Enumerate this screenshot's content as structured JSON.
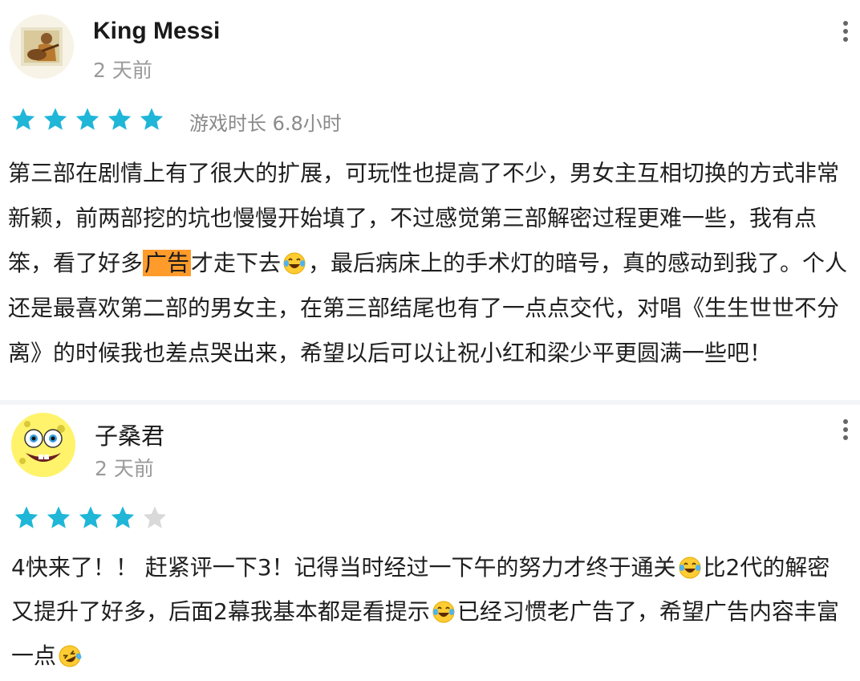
{
  "reviews": [
    {
      "user_name": "King Messi",
      "time_ago": "2 天前",
      "rating": 5,
      "rating_max": 5,
      "playtime": "游戏时长 6.8小时",
      "body_parts": [
        "第三部在剧情上有了很大的扩展，可玩性也提高了不少，男女主互相切换的方式非常新颖，前两部挖的坑也慢慢开始填了，不过感觉第三部解密过程更难一些，我有点笨，看了好多",
        "广告",
        "才走下去",
        "，最后病床上的手术灯的暗号，真的感动到我了。个人还是最喜欢第二部的男女主，在第三部结尾也有了一点点交代，对唱《生生世世不分离》的时候我也差点哭出来，希望以后可以让祝小红和梁少平更圆满一些吧！"
      ],
      "emoji": [
        "laughing-tears-emoji"
      ]
    },
    {
      "user_name": "子桑君",
      "time_ago": "2 天前",
      "rating": 4,
      "rating_max": 5,
      "body_parts": [
        "4快来了！！ 赶紧评一下3！记得当时经过一下午的努力才终于通关",
        "比2代的解密又提升了好多，后面2幕我基本都是看提示",
        "已经习惯老广告了，希望广告内容丰富一点"
      ],
      "emoji": [
        "laughing-tears-emoji",
        "laughing-tears-emoji",
        "rolling-laughing-emoji"
      ]
    }
  ],
  "colors": {
    "star_filled": "#1fb6d8",
    "star_empty": "#d9d9d9",
    "highlight": "#ff9b2b",
    "secondary_text": "#9a9a9a"
  }
}
